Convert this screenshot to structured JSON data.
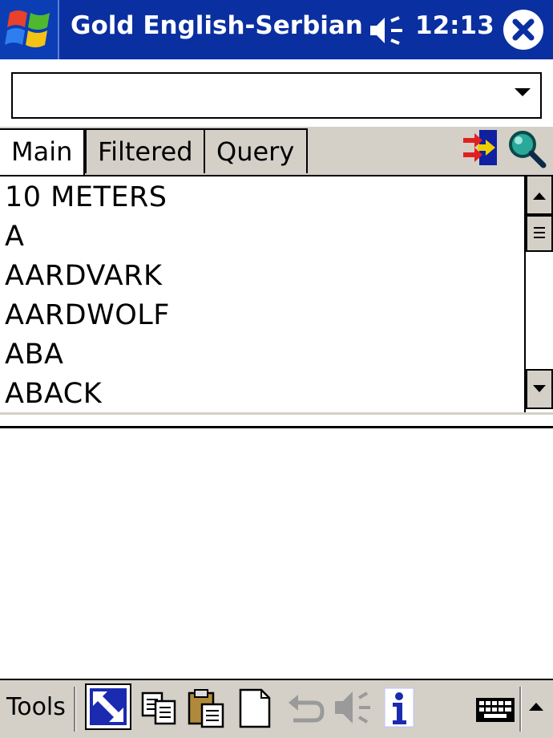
{
  "title_bar": {
    "app_title": "Gold English-Serbian",
    "time": "12:13",
    "start_icon": "windows-flag-icon",
    "speaker_icon": "speaker-icon",
    "close_icon": "close-icon"
  },
  "search": {
    "value": "",
    "placeholder": ""
  },
  "tabs": [
    {
      "label": "Main",
      "selected": true
    },
    {
      "label": "Filtered",
      "selected": false
    },
    {
      "label": "Query",
      "selected": false
    }
  ],
  "header_icons": [
    "swap-direction-icon",
    "search-magnifier-icon"
  ],
  "word_list": [
    "10 METERS",
    "A",
    "AARDVARK",
    "AARDWOLF",
    "ABA",
    "ABACK"
  ],
  "translation": "",
  "toolbar": {
    "tools_label": "Tools",
    "icons": [
      "switch-view-icon",
      "copy-icon",
      "paste-icon",
      "new-document-icon",
      "undo-icon",
      "speak-icon",
      "info-icon",
      "keyboard-icon",
      "input-menu-arrow-icon"
    ]
  },
  "colors": {
    "title_bar": "#0a2fa0",
    "chrome": "#d4d0c8"
  }
}
